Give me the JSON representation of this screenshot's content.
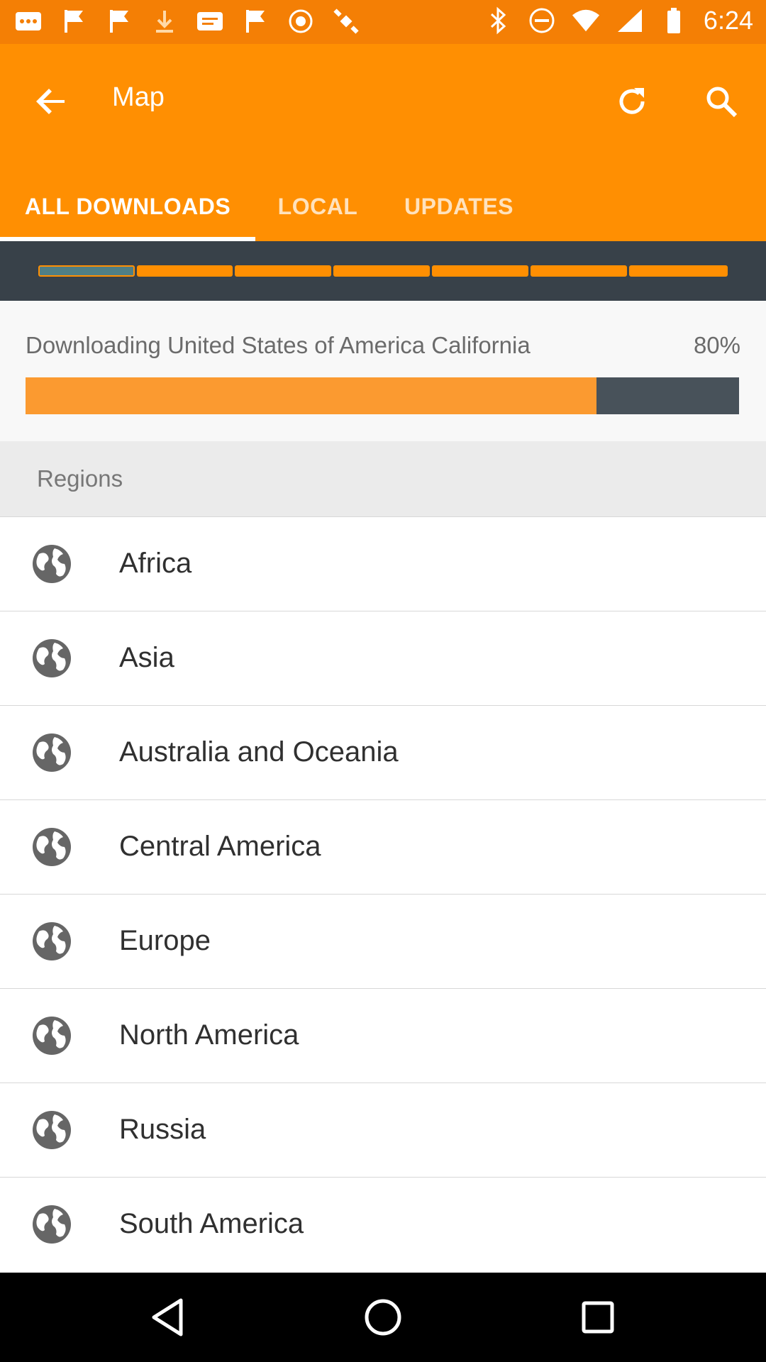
{
  "status_bar": {
    "time": "6:24"
  },
  "app_bar": {
    "title": "Map",
    "back_icon": "arrow-back-icon",
    "refresh_icon": "refresh-icon",
    "search_icon": "search-icon",
    "background_color": "#ff8f02"
  },
  "tabs": [
    {
      "label": "ALL DOWNLOADS",
      "active": true
    },
    {
      "label": "LOCAL",
      "active": false
    },
    {
      "label": "UPDATES",
      "active": false
    }
  ],
  "download": {
    "text": "Downloading United States of America California",
    "percent_label": "80%",
    "progress": 0.8,
    "fill_color": "#fb9a30"
  },
  "regions": {
    "header": "Regions",
    "items": [
      {
        "label": "Africa",
        "icon": "globe-icon"
      },
      {
        "label": "Asia",
        "icon": "globe-icon"
      },
      {
        "label": "Australia and Oceania",
        "icon": "globe-icon"
      },
      {
        "label": "Central America",
        "icon": "globe-icon"
      },
      {
        "label": "Europe",
        "icon": "globe-icon"
      },
      {
        "label": "North America",
        "icon": "globe-icon"
      },
      {
        "label": "Russia",
        "icon": "globe-icon"
      },
      {
        "label": "South America",
        "icon": "globe-icon"
      }
    ]
  },
  "nav_bar": {
    "back_icon": "nav-back-icon",
    "home_icon": "nav-home-icon",
    "recents_icon": "nav-recents-icon"
  }
}
